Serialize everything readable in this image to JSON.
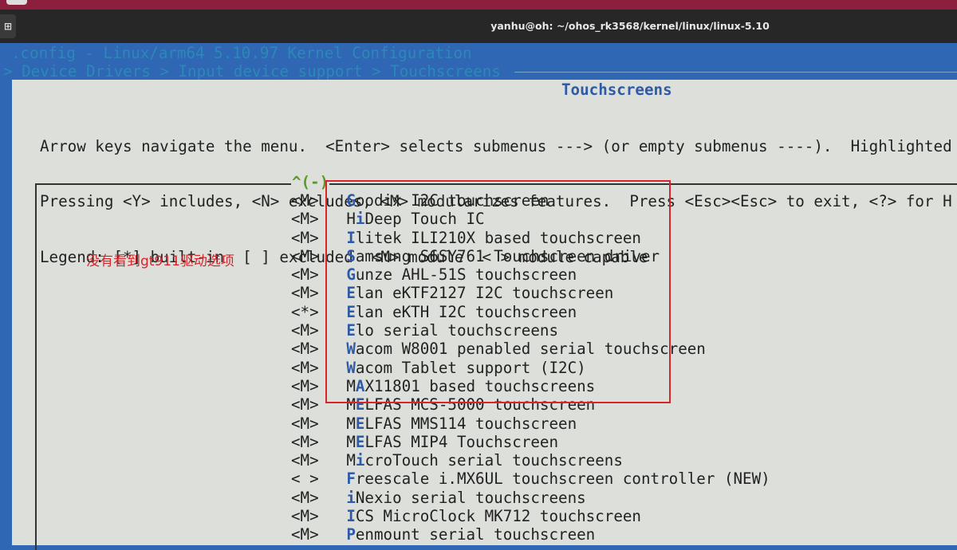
{
  "window": {
    "title": "yanhu@oh: ~/ohos_rk3568/kernel/linux/linux-5.10",
    "new_tab_icon": "new-tab-icon"
  },
  "menuconfig": {
    "config_title": ".config - Linux/arm64 5.10.97 Kernel Configuration",
    "breadcrumb": "> Device Drivers > Input device support > Touchscreens",
    "panel_title": "Touchscreens",
    "help_lines": [
      "Arrow keys navigate the menu.  <Enter> selects submenus ---> (or empty submenus ----).  Highlighted",
      "Pressing <Y> includes, <N> excludes, <M> modularizes features.  Press <Esc><Esc> to exit, <?> for H",
      "Legend: [*] built-in  [ ] excluded  <M> module  < > module capable"
    ],
    "scroll_indicator": "^(-)",
    "items": [
      {
        "state": "<M>",
        "label": "Goodix I2C touchscreen",
        "hotkey": 0
      },
      {
        "state": "<M>",
        "label": "HiDeep Touch IC",
        "hotkey": 1
      },
      {
        "state": "<M>",
        "label": "Ilitek ILI210X based touchscreen",
        "hotkey": 0
      },
      {
        "state": "<M>",
        "label": "Samsung S6SY761 Touchscreen driver",
        "hotkey": 0
      },
      {
        "state": "<M>",
        "label": "Gunze AHL-51S touchscreen",
        "hotkey": 0
      },
      {
        "state": "<M>",
        "label": "Elan eKTF2127 I2C touchscreen",
        "hotkey": 0
      },
      {
        "state": "<*>",
        "label": "Elan eKTH I2C touchscreen",
        "hotkey": 0
      },
      {
        "state": "<M>",
        "label": "Elo serial touchscreens",
        "hotkey": 0
      },
      {
        "state": "<M>",
        "label": "Wacom W8001 penabled serial touchscreen",
        "hotkey": 0
      },
      {
        "state": "<M>",
        "label": "Wacom Tablet support (I2C)",
        "hotkey": 0
      },
      {
        "state": "<M>",
        "label": "MAX11801 based touchscreens",
        "hotkey": 1
      },
      {
        "state": "<M>",
        "label": "MELFAS MCS-5000 touchscreen",
        "hotkey": 1
      },
      {
        "state": "<M>",
        "label": "MELFAS MMS114 touchscreen",
        "hotkey": 1
      },
      {
        "state": "<M>",
        "label": "MELFAS MIP4 Touchscreen",
        "hotkey": 1
      },
      {
        "state": "<M>",
        "label": "MicroTouch serial touchscreens",
        "hotkey": 1
      },
      {
        "state": "< >",
        "label": "Freescale i.MX6UL touchscreen controller (NEW)",
        "hotkey": 0
      },
      {
        "state": "<M>",
        "label": "iNexio serial touchscreens",
        "hotkey": 0
      },
      {
        "state": "<M>",
        "label": "ICS MicroClock MK712 touchscreen",
        "hotkey": 0
      },
      {
        "state": "<M>",
        "label": "Penmount serial touchscreen",
        "hotkey": 0
      }
    ]
  },
  "annotation": {
    "text": "没有看到gt911驱动选项",
    "color": "#d8242a"
  },
  "colors": {
    "background": "#2f67b4",
    "panel": "#dddfda",
    "hotkey": "#2e5aa8",
    "annotation": "#d8242a"
  }
}
